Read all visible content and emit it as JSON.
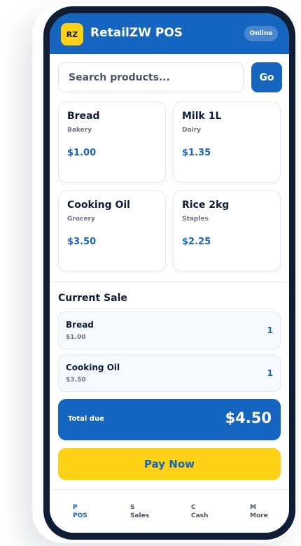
{
  "app": {
    "logo_text": "RZ",
    "title": "RetailZW POS",
    "status": "Online"
  },
  "search": {
    "placeholder": "Search products...",
    "value": "",
    "button_label": "Go"
  },
  "products": [
    {
      "name": "Bread",
      "category": "Bakery",
      "price": "$1.00"
    },
    {
      "name": "Milk 1L",
      "category": "Dairy",
      "price": "$1.35"
    },
    {
      "name": "Cooking Oil",
      "category": "Grocery",
      "price": "$3.50"
    },
    {
      "name": "Rice 2kg",
      "category": "Staples",
      "price": "$2.25"
    }
  ],
  "sale": {
    "title": "Current Sale",
    "items": [
      {
        "name": "Bread",
        "price": "$1.00",
        "qty": "1"
      },
      {
        "name": "Cooking Oil",
        "price": "$3.50",
        "qty": "1"
      }
    ],
    "total_label": "Total due",
    "total_amount": "$4.50",
    "pay_label": "Pay Now"
  },
  "nav": {
    "active": "POS",
    "items": [
      {
        "icon": "P",
        "label": "POS"
      },
      {
        "icon": "S",
        "label": "Sales"
      },
      {
        "icon": "C",
        "label": "Cash"
      },
      {
        "icon": "M",
        "label": "More"
      }
    ]
  },
  "colors": {
    "primary": "#1565c0",
    "accent": "#fcd116",
    "frame": "#0f1e35"
  }
}
